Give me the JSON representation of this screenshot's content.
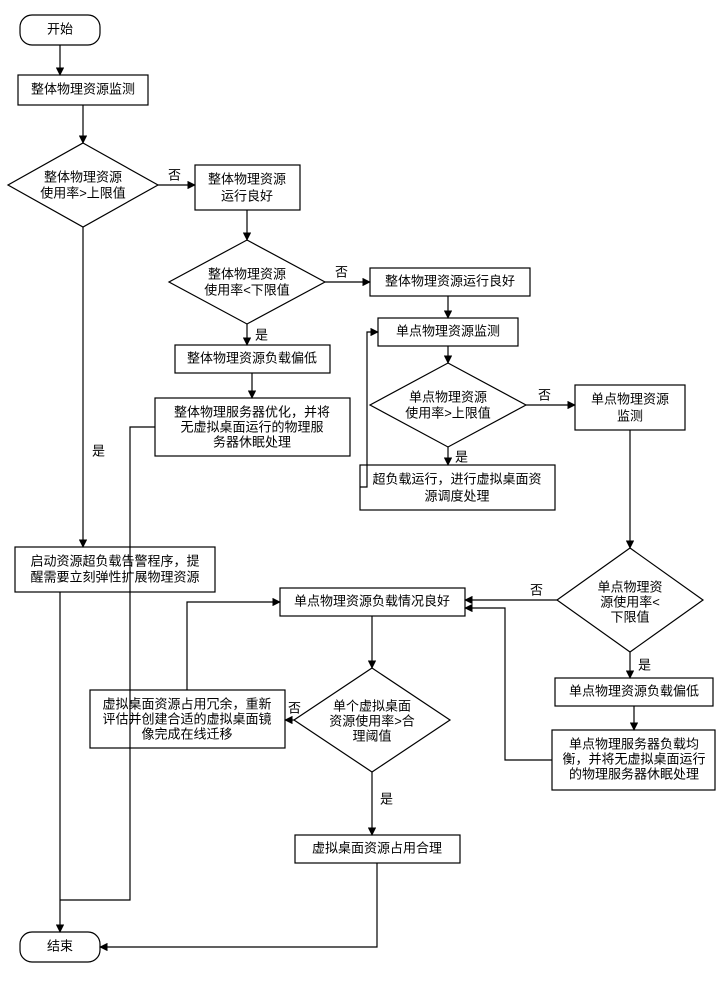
{
  "chart_data": {
    "type": "flowchart",
    "title": "",
    "nodes": [
      {
        "id": "start",
        "type": "terminator",
        "text": "开始"
      },
      {
        "id": "monitor_overall",
        "type": "process",
        "text": "整体物理资源监测"
      },
      {
        "id": "dec_overall_upper",
        "type": "decision",
        "text": "整体物理资源使用率>上限值"
      },
      {
        "id": "overall_good1",
        "type": "process",
        "text": "整体物理资源运行良好"
      },
      {
        "id": "dec_overall_lower",
        "type": "decision",
        "text": "整体物理资源使用率<下限值"
      },
      {
        "id": "overall_good2",
        "type": "process",
        "text": "整体物理资源运行良好"
      },
      {
        "id": "overall_low",
        "type": "process",
        "text": "整体物理资源负载偏低"
      },
      {
        "id": "overall_optimize",
        "type": "process",
        "text": "整体物理服务器优化，并将无虚拟桌面运行的物理服务器休眠处理"
      },
      {
        "id": "single_monitor1",
        "type": "process",
        "text": "单点物理资源监测"
      },
      {
        "id": "dec_single_upper",
        "type": "decision",
        "text": "单点物理资源使用率>上限值"
      },
      {
        "id": "overload_sched",
        "type": "process",
        "text": "超负载运行，进行虚拟桌面资源调度处理"
      },
      {
        "id": "single_monitor2",
        "type": "process",
        "text": "单点物理资源监测"
      },
      {
        "id": "dec_single_lower",
        "type": "decision",
        "text": "单点物理资源使用率<下限值"
      },
      {
        "id": "single_low",
        "type": "process",
        "text": "单点物理资源负载偏低"
      },
      {
        "id": "single_balance",
        "type": "process",
        "text": "单点物理服务器负载均衡，并将无虚拟桌面运行的物理服务器休眠处理"
      },
      {
        "id": "single_good",
        "type": "process",
        "text": "单点物理资源负载情况良好"
      },
      {
        "id": "alarm",
        "type": "process",
        "text": "启动资源超负载告警程序，提醒需要立刻弹性扩展物理资源"
      },
      {
        "id": "dec_vm_reasonable",
        "type": "decision",
        "text": "单个虚拟桌面资源使用率>合理阈值"
      },
      {
        "id": "vm_redundant",
        "type": "process",
        "text": "虚拟桌面资源占用冗余，重新评估并创建合适的虚拟桌面镜像完成在线迁移"
      },
      {
        "id": "vm_reasonable",
        "type": "process",
        "text": "虚拟桌面资源占用合理"
      },
      {
        "id": "end",
        "type": "terminator",
        "text": "结束"
      }
    ],
    "edges": [
      {
        "from": "start",
        "to": "monitor_overall"
      },
      {
        "from": "monitor_overall",
        "to": "dec_overall_upper"
      },
      {
        "from": "dec_overall_upper",
        "to": "overall_good1",
        "label": "否"
      },
      {
        "from": "dec_overall_upper",
        "to": "alarm",
        "label": "是"
      },
      {
        "from": "overall_good1",
        "to": "dec_overall_lower"
      },
      {
        "from": "dec_overall_lower",
        "to": "overall_good2",
        "label": "否"
      },
      {
        "from": "dec_overall_lower",
        "to": "overall_low",
        "label": "是"
      },
      {
        "from": "overall_low",
        "to": "overall_optimize"
      },
      {
        "from": "overall_good2",
        "to": "single_monitor1"
      },
      {
        "from": "single_monitor1",
        "to": "dec_single_upper"
      },
      {
        "from": "dec_single_upper",
        "to": "overload_sched",
        "label": "是"
      },
      {
        "from": "dec_single_upper",
        "to": "single_monitor2",
        "label": "否"
      },
      {
        "from": "overload_sched",
        "to": "single_monitor1"
      },
      {
        "from": "single_monitor2",
        "to": "dec_single_lower"
      },
      {
        "from": "dec_single_lower",
        "to": "single_low",
        "label": "是"
      },
      {
        "from": "dec_single_lower",
        "to": "single_good",
        "label": "否"
      },
      {
        "from": "single_low",
        "to": "single_balance"
      },
      {
        "from": "single_balance",
        "to": "single_good"
      },
      {
        "from": "single_good",
        "to": "dec_vm_reasonable"
      },
      {
        "from": "dec_vm_reasonable",
        "to": "vm_redundant",
        "label": "否"
      },
      {
        "from": "dec_vm_reasonable",
        "to": "vm_reasonable",
        "label": "是"
      },
      {
        "from": "vm_redundant",
        "to": "single_good"
      },
      {
        "from": "alarm",
        "to": "end"
      },
      {
        "from": "vm_reasonable",
        "to": "end"
      },
      {
        "from": "overall_optimize",
        "to": "end"
      }
    ]
  },
  "nodes": {
    "start": "开始",
    "monitor_overall": "整体物理资源监测",
    "dec_overall_upper_l1": "整体物理资源",
    "dec_overall_upper_l2": "使用率>上限值",
    "overall_good1_l1": "整体物理资源",
    "overall_good1_l2": "运行良好",
    "dec_overall_lower_l1": "整体物理资源",
    "dec_overall_lower_l2": "使用率<下限值",
    "overall_good2": "整体物理资源运行良好",
    "overall_low": "整体物理资源负载偏低",
    "overall_optimize_l1": "整体物理服务器优化，并将",
    "overall_optimize_l2": "无虚拟桌面运行的物理服",
    "overall_optimize_l3": "务器休眠处理",
    "single_monitor1": "单点物理资源监测",
    "dec_single_upper_l1": "单点物理资源",
    "dec_single_upper_l2": "使用率>上限值",
    "overload_sched_l1": "超负载运行，进行虚拟桌面资",
    "overload_sched_l2": "源调度处理",
    "single_monitor2_l1": "单点物理资源",
    "single_monitor2_l2": "监测",
    "dec_single_lower_l1": "单点物理资",
    "dec_single_lower_l2": "源使用率<",
    "dec_single_lower_l3": "下限值",
    "single_low": "单点物理资源负载偏低",
    "single_balance_l1": "单点物理服务器负载均",
    "single_balance_l2": "衡，并将无虚拟桌面运行",
    "single_balance_l3": "的物理服务器休眠处理",
    "single_good": "单点物理资源负载情况良好",
    "alarm_l1": "启动资源超负载告警程序，提",
    "alarm_l2": "醒需要立刻弹性扩展物理资源",
    "dec_vm_reasonable_l1": "单个虚拟桌面",
    "dec_vm_reasonable_l2": "资源使用率>合",
    "dec_vm_reasonable_l3": "理阈值",
    "vm_redundant_l1": "虚拟桌面资源占用冗余，重新",
    "vm_redundant_l2": "评估并创建合适的虚拟桌面镜",
    "vm_redundant_l3": "像完成在线迁移",
    "vm_reasonable": "虚拟桌面资源占用合理",
    "end": "结束"
  },
  "labels": {
    "yes": "是",
    "no": "否"
  }
}
